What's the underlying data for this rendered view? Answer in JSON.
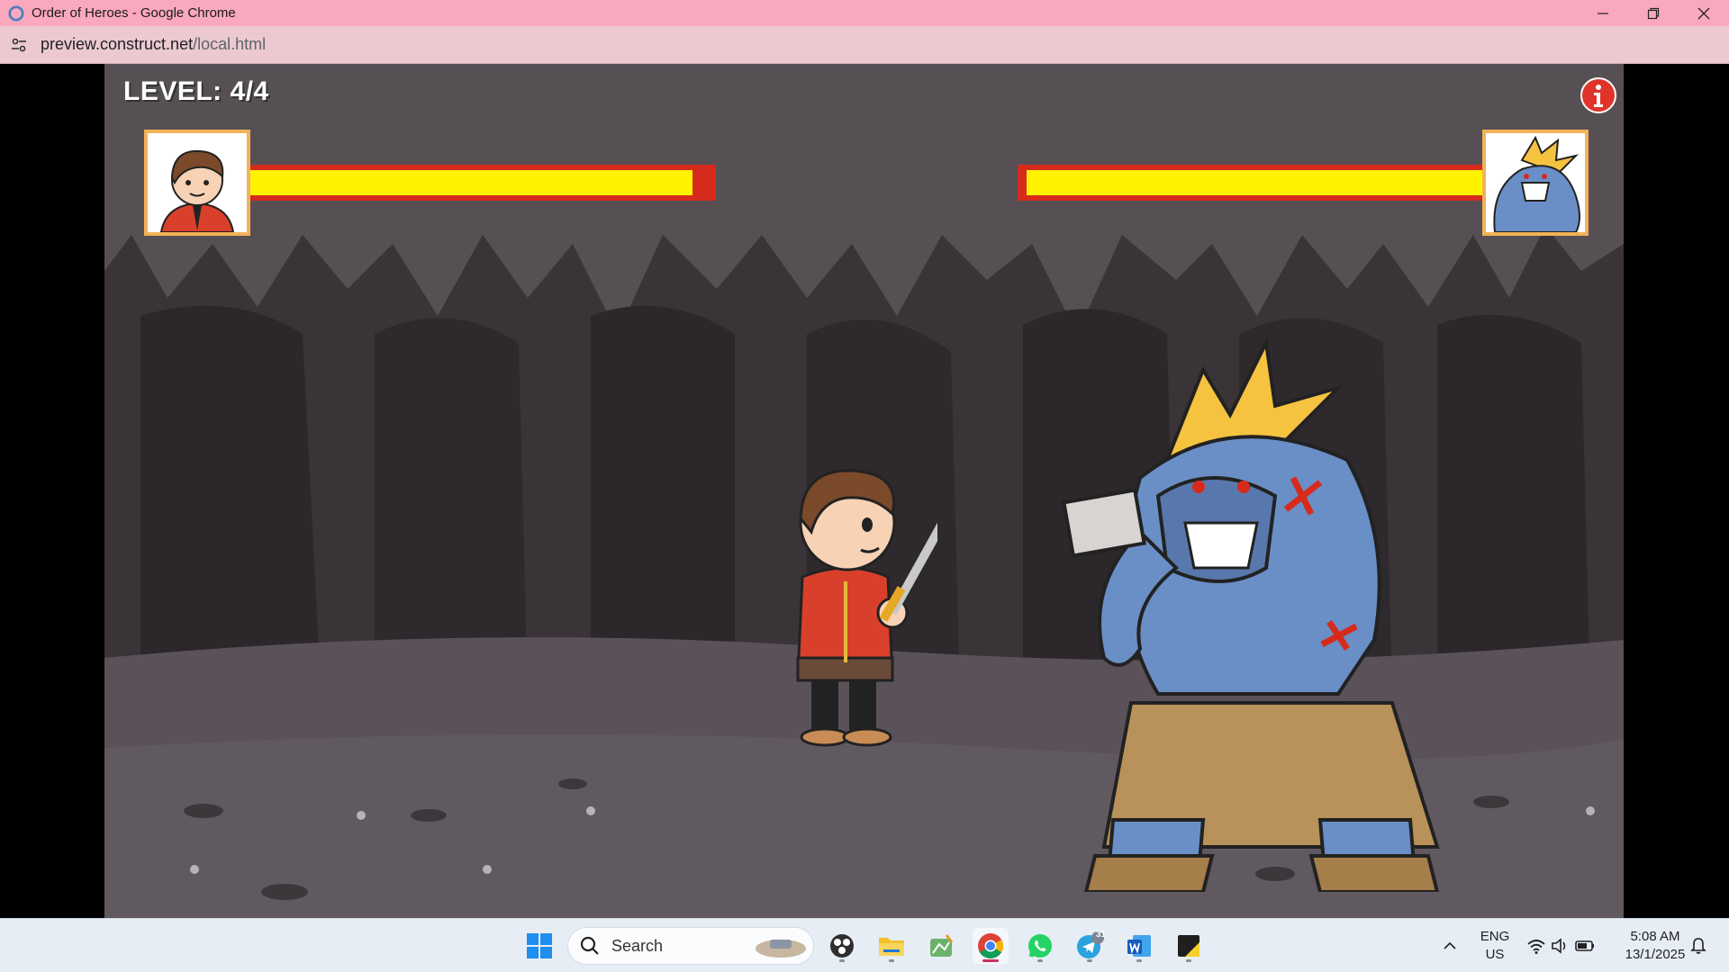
{
  "window": {
    "title": "Order of Heroes - Google Chrome",
    "url_host": "preview.construct.net",
    "url_path": "/local.html"
  },
  "game": {
    "level_label": "LEVEL: 4/4",
    "hero_health_fraction": 0.95,
    "enemy_health_fraction": 0.98,
    "colors": {
      "health_fill": "#fff200",
      "health_background": "#d62b1c",
      "portrait_border": "#f2b25a",
      "cave_background": "#4a4449"
    },
    "icons": [
      "info-icon",
      "hero-portrait",
      "enemy-portrait"
    ]
  },
  "taskbar": {
    "search_label": "Search",
    "telegram_badge": "31",
    "lang_line1": "ENG",
    "lang_line2": "US",
    "time": "5:08 AM",
    "date": "13/1/2025"
  }
}
